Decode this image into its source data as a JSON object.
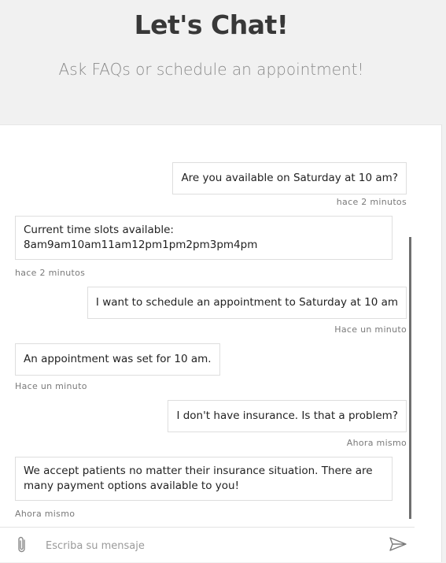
{
  "header": {
    "title": "Let's Chat!",
    "subtitle": "Ask FAQs or schedule an appointment!"
  },
  "messages": [
    {
      "side": "user",
      "text": "Are you available on Saturday at 10 am?",
      "time": "hace 2 minutos"
    },
    {
      "side": "bot",
      "text_line1": "Current time slots available:",
      "text_line2": "8am9am10am11am12pm1pm2pm3pm4pm",
      "time": "hace 2 minutos"
    },
    {
      "side": "user",
      "text": "I want to schedule an appointment to Saturday at 10 am",
      "time": "Hace un minuto"
    },
    {
      "side": "bot",
      "text": "An appointment was set for 10 am.",
      "time": "Hace un minuto"
    },
    {
      "side": "user",
      "text": "I don't have insurance. Is that a problem?",
      "time": "Ahora mismo"
    },
    {
      "side": "bot",
      "text": "We accept patients no matter their insurance situation. There are many payment options available to you!",
      "time": "Ahora mismo"
    }
  ],
  "composer": {
    "placeholder": "Escriba su mensaje",
    "value": "",
    "attach_icon": "paperclip-icon",
    "send_icon": "send-icon"
  },
  "colors": {
    "page_background": "#f1f1f1",
    "panel_background": "#ffffff",
    "bubble_border": "#dedede",
    "title": "#383838",
    "subtitle": "#8a8a8a",
    "timestamp": "#7a7a7a",
    "scrollbar": "#6f6f6f"
  }
}
